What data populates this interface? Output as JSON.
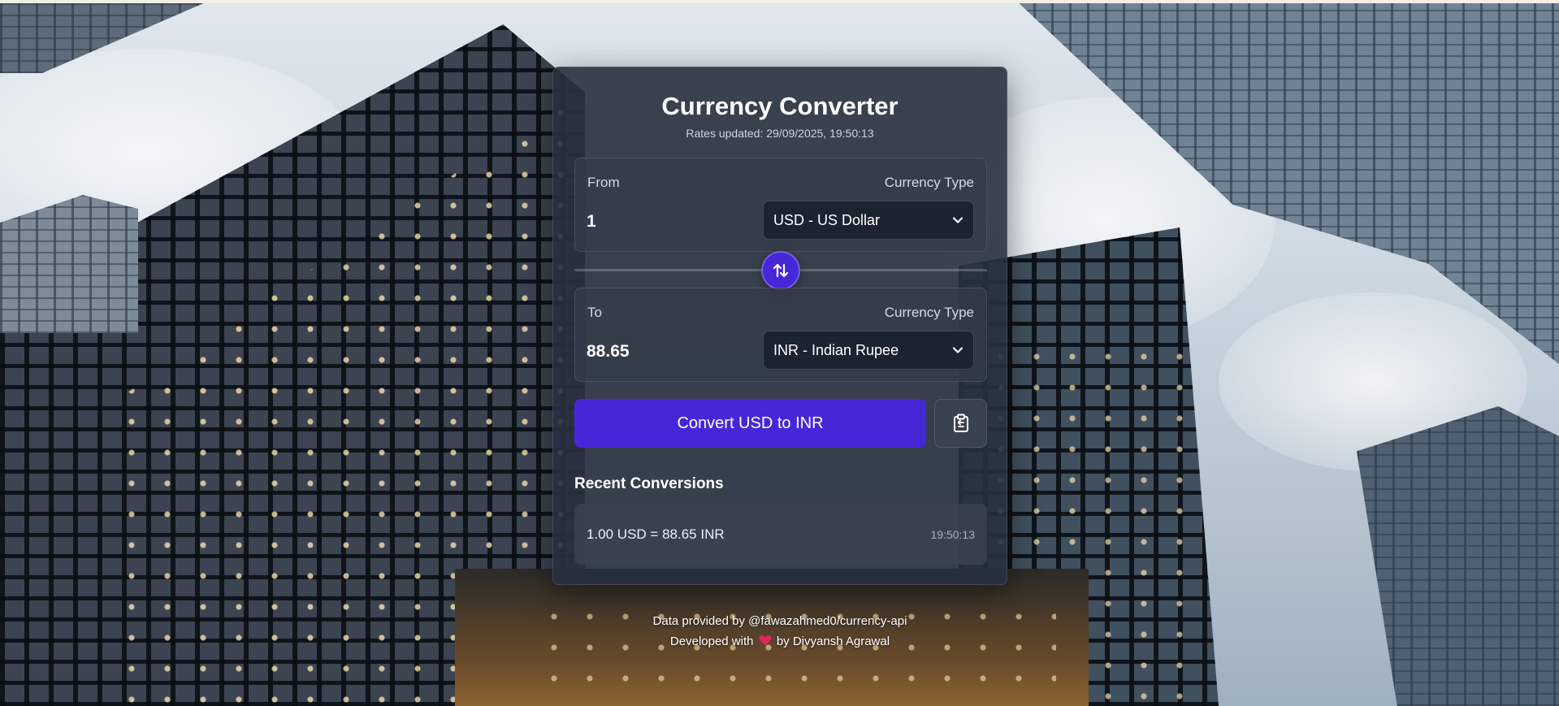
{
  "app": {
    "title": "Currency Converter",
    "rates_updated": "Rates updated: 29/09/2025, 19:50:13"
  },
  "from_panel": {
    "label": "From",
    "type_label": "Currency Type",
    "amount": "1",
    "currency": "USD - US Dollar"
  },
  "to_panel": {
    "label": "To",
    "type_label": "Currency Type",
    "amount": "88.65",
    "currency": "INR - Indian Rupee"
  },
  "actions": {
    "convert_label": "Convert USD to INR",
    "swap_icon": "swap-arrows-icon",
    "copy_icon": "clipboard-icon"
  },
  "recent": {
    "title": "Recent Conversions",
    "items": [
      {
        "text": "1.00 USD = 88.65 INR",
        "time": "19:50:13"
      }
    ]
  },
  "footer": {
    "data_credit": "Data provided by @fawazahmed0/currency-api",
    "dev_prefix": "Developed with",
    "dev_suffix": "by Divyansh Agrawal"
  },
  "colors": {
    "accent": "#4527d8",
    "card_bg": "#28303e",
    "select_bg": "#1b2230",
    "heart": "#e0245e"
  }
}
